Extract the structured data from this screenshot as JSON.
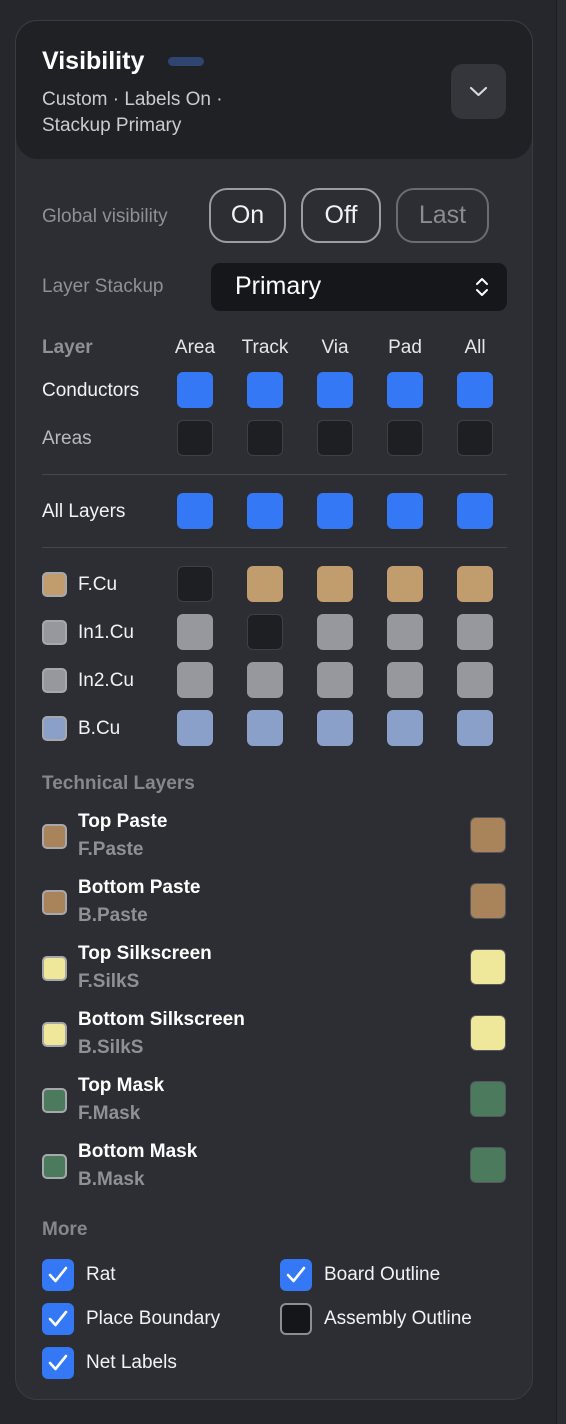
{
  "header": {
    "title": "Visibility",
    "subtitle": "Custom · Labels On · Stackup Primary",
    "collapse_icon": "chevron-down-icon"
  },
  "global_visibility": {
    "label": "Global visibility",
    "buttons": [
      "On",
      "Off",
      "Last"
    ]
  },
  "layer_stackup": {
    "label": "Layer Stackup",
    "value": "Primary",
    "icon": "updown-chevron-icon"
  },
  "grid": {
    "layer_header": "Layer",
    "columns": [
      "Area",
      "Track",
      "Via",
      "Pad",
      "All"
    ],
    "rows": [
      {
        "label": "Conductors",
        "cells": [
          "blue",
          "blue",
          "blue",
          "blue",
          "blue"
        ]
      },
      {
        "label": "Areas",
        "cells": [
          "dark",
          "dark",
          "dark",
          "dark",
          "dark"
        ]
      },
      {
        "label": "All Layers",
        "cells": [
          "blue",
          "blue",
          "blue",
          "blue",
          "blue"
        ]
      }
    ],
    "layers": [
      {
        "label": "F.Cu",
        "color": "#c19c6c",
        "cells": [
          "dark",
          "tan",
          "tan",
          "tan",
          "tan"
        ]
      },
      {
        "label": "In1.Cu",
        "color": "#97989d",
        "cells": [
          "gray",
          "dark",
          "gray",
          "gray",
          "gray"
        ]
      },
      {
        "label": "In2.Cu",
        "color": "#97989d",
        "cells": [
          "gray",
          "gray",
          "gray",
          "gray",
          "gray"
        ]
      },
      {
        "label": "B.Cu",
        "color": "#8aa0c8",
        "cells": [
          "lblue",
          "lblue",
          "lblue",
          "lblue",
          "lblue"
        ]
      }
    ]
  },
  "technical": {
    "title": "Technical Layers",
    "items": [
      {
        "name": "Top Paste",
        "sub": "F.Paste",
        "color": "#a9835a"
      },
      {
        "name": "Bottom Paste",
        "sub": "B.Paste",
        "color": "#a9835a"
      },
      {
        "name": "Top Silkscreen",
        "sub": "F.SilkS",
        "color": "#efe799"
      },
      {
        "name": "Bottom Silkscreen",
        "sub": "B.SilkS",
        "color": "#efe799"
      },
      {
        "name": "Top Mask",
        "sub": "F.Mask",
        "color": "#4c7a5c"
      },
      {
        "name": "Bottom Mask",
        "sub": "B.Mask",
        "color": "#4c7a5c"
      }
    ]
  },
  "more": {
    "title": "More",
    "options": [
      {
        "label": "Rat",
        "checked": true
      },
      {
        "label": "Board Outline",
        "checked": true
      },
      {
        "label": "Place Boundary",
        "checked": true
      },
      {
        "label": "Assembly Outline",
        "checked": false
      },
      {
        "label": "Net Labels",
        "checked": true
      }
    ]
  },
  "colors": {
    "accent": "#3478f6",
    "panel": "#2c2e33",
    "header": "#1f2125"
  }
}
